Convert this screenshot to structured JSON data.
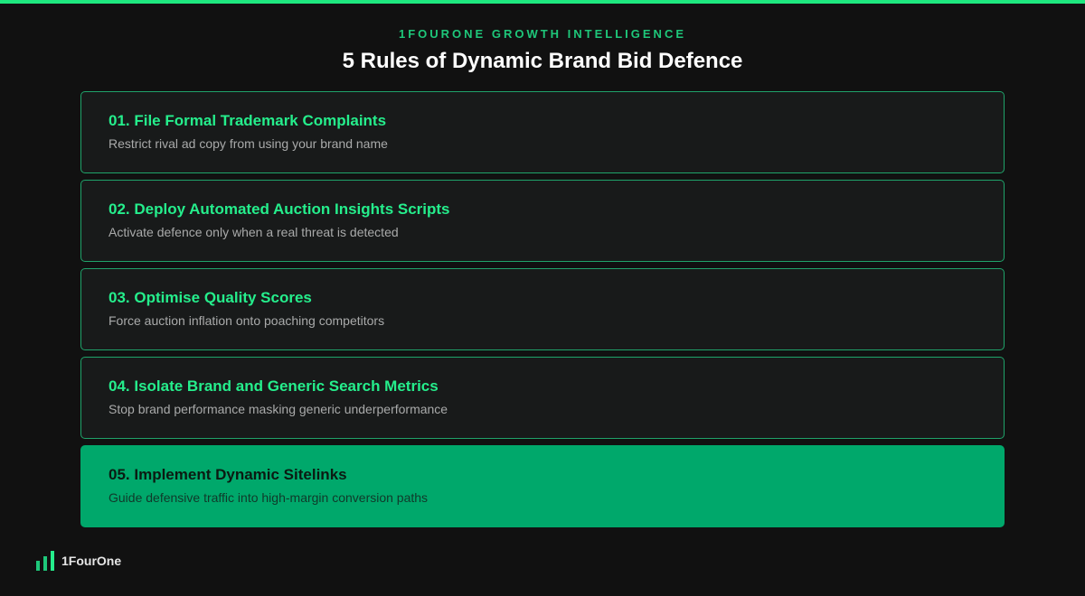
{
  "header": {
    "eyebrow": "1FOURONE GROWTH INTELLIGENCE",
    "title": "5 Rules of Dynamic Brand Bid Defence"
  },
  "rules": [
    {
      "title": "01. File Formal Trademark Complaints",
      "description": "Restrict rival ad copy from using your brand name",
      "highlighted": false
    },
    {
      "title": "02. Deploy Automated Auction Insights Scripts",
      "description": "Activate defence only when a real threat is detected",
      "highlighted": false
    },
    {
      "title": "03. Optimise Quality Scores",
      "description": "Force auction inflation onto poaching competitors",
      "highlighted": false
    },
    {
      "title": "04. Isolate Brand and Generic Search Metrics",
      "description": "Stop brand performance masking generic underperformance",
      "highlighted": false
    },
    {
      "title": "05. Implement Dynamic Sitelinks",
      "description": "Guide defensive traffic into high-margin conversion paths",
      "highlighted": true
    }
  ],
  "footer": {
    "brand": "1FourOne",
    "logo_icon": "bar-chart-icon"
  },
  "colors": {
    "background": "#111111",
    "accent": "#1ee87f",
    "accent_dark": "#00a86b",
    "card": "#181a1a"
  }
}
